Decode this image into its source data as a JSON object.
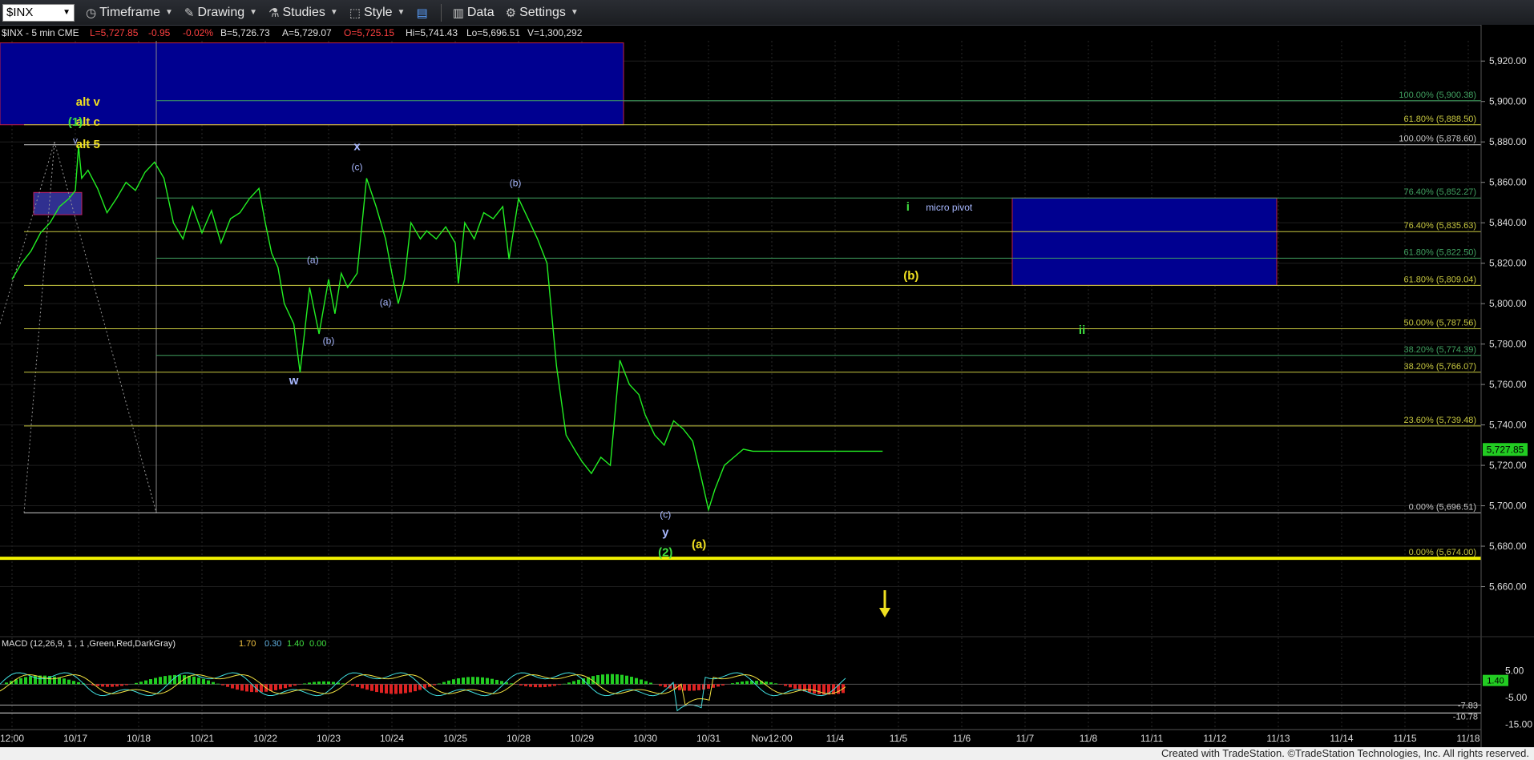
{
  "toolbar": {
    "symbol": "$INX",
    "timeframe": "Timeframe",
    "drawing": "Drawing",
    "studies": "Studies",
    "style": "Style",
    "data": "Data",
    "settings": "Settings"
  },
  "header": {
    "symbol": "$INX - 5 min CME",
    "last": "L=5,727.85",
    "change": "-0.95",
    "pct": "-0.02%",
    "bid": "B=5,726.73",
    "ask": "A=5,729.07",
    "open": "O=5,725.15",
    "high": "Hi=5,741.43",
    "low": "Lo=5,696.51",
    "volume": "V=1,300,292"
  },
  "footer": {
    "credit": "Created with TradeStation. ©TradeStation Technologies, Inc. All rights reserved."
  },
  "colors": {
    "price": "#22ee22",
    "fib_yellow": "#c8c840",
    "fib_green": "#40a060",
    "fib_white": "#c8c8c8",
    "box": "#000090",
    "box_border": "#c02040",
    "label_yellow": "#f0e020",
    "label_green": "#40e040",
    "label_blue": "#a8b8ff"
  },
  "chart_data": {
    "type": "line",
    "y_axis": {
      "ylim": [
        5640,
        5930
      ],
      "ticks": [
        "5,920.00",
        "5,900.00",
        "5,880.00",
        "5,860.00",
        "5,840.00",
        "5,820.00",
        "5,800.00",
        "5,780.00",
        "5,760.00",
        "5,740.00",
        "5,720.00",
        "5,700.00",
        "5,680.00",
        "5,660.00"
      ],
      "last_price": "5,727.85"
    },
    "x_axis": {
      "ticks": [
        "12:00",
        "10/17",
        "10/18",
        "10/21",
        "10/22",
        "10/23",
        "10/24",
        "10/25",
        "10/28",
        "10/29",
        "10/30",
        "10/31",
        "Nov12:00",
        "11/4",
        "11/5",
        "11/6",
        "11/7",
        "11/8",
        "11/11",
        "11/12",
        "11/13",
        "11/14",
        "11/15",
        "11/18"
      ]
    },
    "series": [
      {
        "x": [
          0.0,
          0.15,
          0.3,
          0.45,
          0.6,
          0.75,
          0.9,
          1.0,
          1.05,
          1.1,
          1.2,
          1.35,
          1.5,
          1.65,
          1.8,
          1.95,
          2.1,
          2.25,
          2.4,
          2.55,
          2.7,
          2.85,
          3.0,
          3.15,
          3.3,
          3.45,
          3.6,
          3.75,
          3.9,
          4.0,
          4.1,
          4.2,
          4.3,
          4.45,
          4.55,
          4.7,
          4.85,
          5.0,
          5.1,
          5.2,
          5.3,
          5.45,
          5.6,
          5.75,
          5.9,
          6.0,
          6.1,
          6.2,
          6.3,
          6.45,
          6.55,
          6.7,
          6.85,
          7.0,
          7.05,
          7.15,
          7.3,
          7.45,
          7.6,
          7.75,
          7.85,
          8.0,
          8.15,
          8.3,
          8.45,
          8.6,
          8.75,
          8.9,
          9.0,
          9.15,
          9.3,
          9.45,
          9.6,
          9.75,
          9.9,
          10.0,
          10.15,
          10.3,
          10.45,
          10.6,
          10.75,
          10.9,
          11.0,
          11.1,
          11.25,
          11.4,
          11.55,
          11.7,
          11.85,
          12.0,
          12.1,
          12.25,
          12.4,
          12.55,
          12.7,
          12.85,
          13.0,
          13.15,
          13.25,
          13.35,
          13.5,
          13.65,
          13.75
        ],
        "values": [
          5812,
          5820,
          5826,
          5835,
          5840,
          5848,
          5852,
          5856,
          5878,
          5862,
          5866,
          5857,
          5845,
          5852,
          5860,
          5856,
          5865,
          5870,
          5862,
          5840,
          5832,
          5848,
          5835,
          5846,
          5830,
          5842,
          5845,
          5852,
          5857,
          5840,
          5825,
          5818,
          5800,
          5790,
          5766,
          5808,
          5785,
          5812,
          5795,
          5815,
          5808,
          5815,
          5862,
          5848,
          5832,
          5815,
          5800,
          5812,
          5840,
          5832,
          5836,
          5832,
          5838,
          5830,
          5810,
          5840,
          5832,
          5845,
          5842,
          5848,
          5822,
          5852,
          5842,
          5832,
          5820,
          5769,
          5735,
          5727,
          5722,
          5716,
          5724,
          5720,
          5772,
          5760,
          5755,
          5745,
          5735,
          5730,
          5742,
          5738,
          5732,
          5712,
          5698,
          5708,
          5720,
          5724,
          5728,
          5727,
          5727,
          5727,
          5727,
          5727,
          5727,
          5727,
          5727,
          5727,
          5727,
          5727,
          5727,
          5727,
          5727,
          5727,
          5727
        ]
      }
    ],
    "fib_levels": [
      {
        "label": "100.00% (5,900.38)",
        "value": 5900.38,
        "color": "green"
      },
      {
        "label": "61.80% (5,888.50)",
        "value": 5888.5,
        "color": "yellow"
      },
      {
        "label": "100.00% (5,878.60)",
        "value": 5878.6,
        "color": "white"
      },
      {
        "label": "76.40% (5,852.27)",
        "value": 5852.27,
        "color": "green"
      },
      {
        "label": "76.40% (5,835.63)",
        "value": 5835.63,
        "color": "yellow"
      },
      {
        "label": "61.80% (5,822.50)",
        "value": 5822.5,
        "color": "green"
      },
      {
        "label": "61.80% (5,809.04)",
        "value": 5809.04,
        "color": "yellow"
      },
      {
        "label": "50.00% (5,787.56)",
        "value": 5787.56,
        "color": "yellow"
      },
      {
        "label": "38.20% (5,774.39)",
        "value": 5774.39,
        "color": "green"
      },
      {
        "label": "38.20% (5,766.07)",
        "value": 5766.07,
        "color": "yellow"
      },
      {
        "label": "23.60% (5,739.48)",
        "value": 5739.48,
        "color": "yellow"
      },
      {
        "label": "0.00% (5,696.51)",
        "value": 5696.51,
        "color": "white"
      },
      {
        "label": "0.00% (5,674.00)",
        "value": 5674.0,
        "color": "yellow"
      }
    ],
    "wave_labels": [
      {
        "text": "alt v",
        "x": 1.2,
        "value": 5898,
        "color": "yellow"
      },
      {
        "text": "alt c",
        "x": 1.2,
        "value": 5888,
        "color": "yellow"
      },
      {
        "text": "alt 5",
        "x": 1.2,
        "value": 5877,
        "color": "yellow"
      },
      {
        "text": "(1)",
        "x": 1.0,
        "value": 5888,
        "color": "green"
      },
      {
        "text": "v",
        "x": 1.0,
        "value": 5879,
        "color": "blue"
      },
      {
        "text": "x",
        "x": 5.45,
        "value": 5876,
        "color": "blue"
      },
      {
        "text": "(c)",
        "x": 5.45,
        "value": 5866,
        "color": "blue"
      },
      {
        "text": "(b)",
        "x": 7.95,
        "value": 5858,
        "color": "blue"
      },
      {
        "text": "(a)",
        "x": 4.75,
        "value": 5820,
        "color": "blue"
      },
      {
        "text": "(a)",
        "x": 5.9,
        "value": 5799,
        "color": "blue"
      },
      {
        "text": "(b)",
        "x": 5.0,
        "value": 5780,
        "color": "blue"
      },
      {
        "text": "w",
        "x": 4.45,
        "value": 5760,
        "color": "blue"
      },
      {
        "text": "(c)",
        "x": 10.32,
        "value": 5694,
        "color": "blue"
      },
      {
        "text": "y",
        "x": 10.32,
        "value": 5685,
        "color": "blue"
      },
      {
        "text": "(2)",
        "x": 10.32,
        "value": 5675,
        "color": "green"
      },
      {
        "text": "(a)",
        "x": 10.85,
        "value": 5679,
        "color": "yellow"
      },
      {
        "text": "(b)",
        "x": 14.2,
        "value": 5812,
        "color": "yellow"
      },
      {
        "text": "i",
        "x": 14.15,
        "value": 5846,
        "color": "green"
      },
      {
        "text": "ii",
        "x": 16.9,
        "value": 5785,
        "color": "green"
      },
      {
        "text": "micro pivot",
        "x": 14.8,
        "value": 5846,
        "color": "blue"
      }
    ],
    "macd": {
      "label": "MACD (12,26,9, 1 , 1 ,Green,Red,DarkGray)",
      "values": [
        "1.70",
        "0.30",
        "1.40",
        "0.00"
      ],
      "ticks": [
        "5.00",
        "-5.00",
        "-15.00"
      ],
      "right_labels": [
        "1.40",
        "-7.83",
        "-10.78"
      ]
    }
  }
}
